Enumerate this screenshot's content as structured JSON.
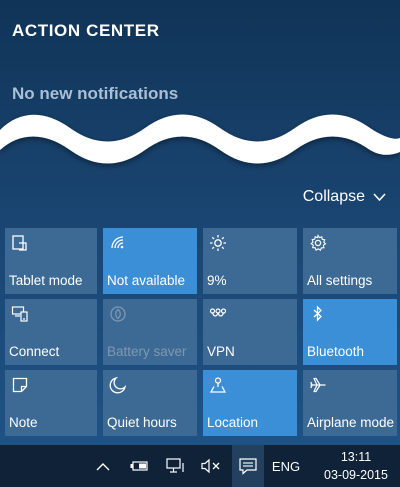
{
  "header": {
    "title": "ACTION CENTER"
  },
  "notifications": {
    "empty_text": "No new notifications"
  },
  "collapse": {
    "label": "Collapse",
    "icon": "chevron-down-icon"
  },
  "tiles": [
    {
      "label": "Tablet mode",
      "icon": "tablet-mode-icon",
      "state": "off"
    },
    {
      "label": "Not available",
      "icon": "wifi-icon",
      "state": "on"
    },
    {
      "label": "9%",
      "icon": "brightness-icon",
      "state": "off"
    },
    {
      "label": "All settings",
      "icon": "gear-icon",
      "state": "off"
    },
    {
      "label": "Connect",
      "icon": "connect-icon",
      "state": "off"
    },
    {
      "label": "Battery saver",
      "icon": "battery-saver-icon",
      "state": "disabled"
    },
    {
      "label": "VPN",
      "icon": "vpn-icon",
      "state": "off"
    },
    {
      "label": "Bluetooth",
      "icon": "bluetooth-icon",
      "state": "on"
    },
    {
      "label": "Note",
      "icon": "note-icon",
      "state": "off"
    },
    {
      "label": "Quiet hours",
      "icon": "moon-icon",
      "state": "off"
    },
    {
      "label": "Location",
      "icon": "location-icon",
      "state": "on"
    },
    {
      "label": "Airplane mode",
      "icon": "airplane-icon",
      "state": "off"
    }
  ],
  "taskbar": {
    "language": "ENG",
    "time": "13:11",
    "date": "03-09-2015",
    "icons": [
      "chevron-up-icon",
      "battery-icon",
      "network-icon",
      "volume-muted-icon",
      "action-center-icon"
    ]
  },
  "colors": {
    "tile_off": "#3d6a94",
    "tile_on": "#3a8fd6",
    "panel_bg": "#1a4572",
    "taskbar_bg": "#0f2237"
  }
}
